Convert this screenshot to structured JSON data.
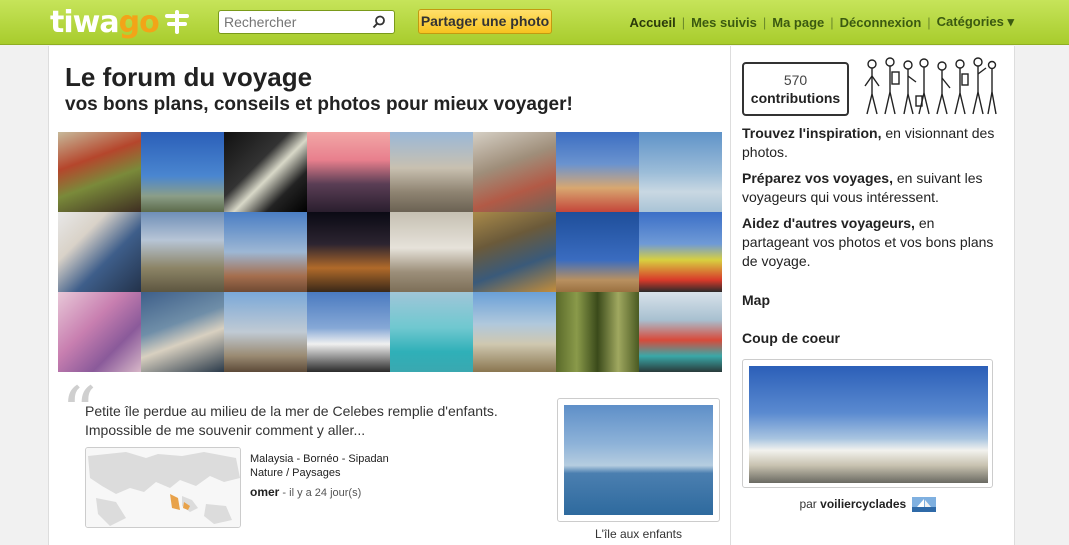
{
  "header": {
    "logo_text": "tiwago",
    "search_placeholder": "Rechercher",
    "share_label": "Partager une photo",
    "nav": [
      "Accueil",
      "Mes suivis",
      "Ma page",
      "Déconnexion",
      "Catégories ▾"
    ]
  },
  "main": {
    "title": "Le forum du voyage",
    "subtitle": "vos bons plans, conseils et photos pour mieux voyager!",
    "mosaic_tiles": 24,
    "featured": {
      "quote": "Petite île perdue au milieu de la mer de Celebes remplie d'enfants. Impossible de me souvenir comment y aller...",
      "location": "Malaysia - Bornéo - Sipadan",
      "category": "Nature / Paysages",
      "author": "omer",
      "when": "- il y a 24 jour(s)",
      "photo_caption": "L'île aux enfants"
    }
  },
  "sidebar": {
    "contrib_count": "570",
    "contrib_label": "contributions",
    "tag1_bold": "Trouvez l'inspiration,",
    "tag1_rest": " en visionnant des photos.",
    "tag2_bold": "Préparez vos voyages,",
    "tag2_rest": " en suivant les voyageurs qui vous intéressent.",
    "tag3_bold": "Aidez d'autres voyageurs,",
    "tag3_rest": " en partageant vos photos et vos bons plans de voyage.",
    "map_heading": "Map",
    "coeur_heading": "Coup de coeur",
    "coeur_by_prefix": "par ",
    "coeur_by_user": "voiliercyclades"
  },
  "colors": {
    "header_green": "#b5d63c",
    "button_yellow": "#f7c21f",
    "logo_orange": "#f2a418"
  }
}
